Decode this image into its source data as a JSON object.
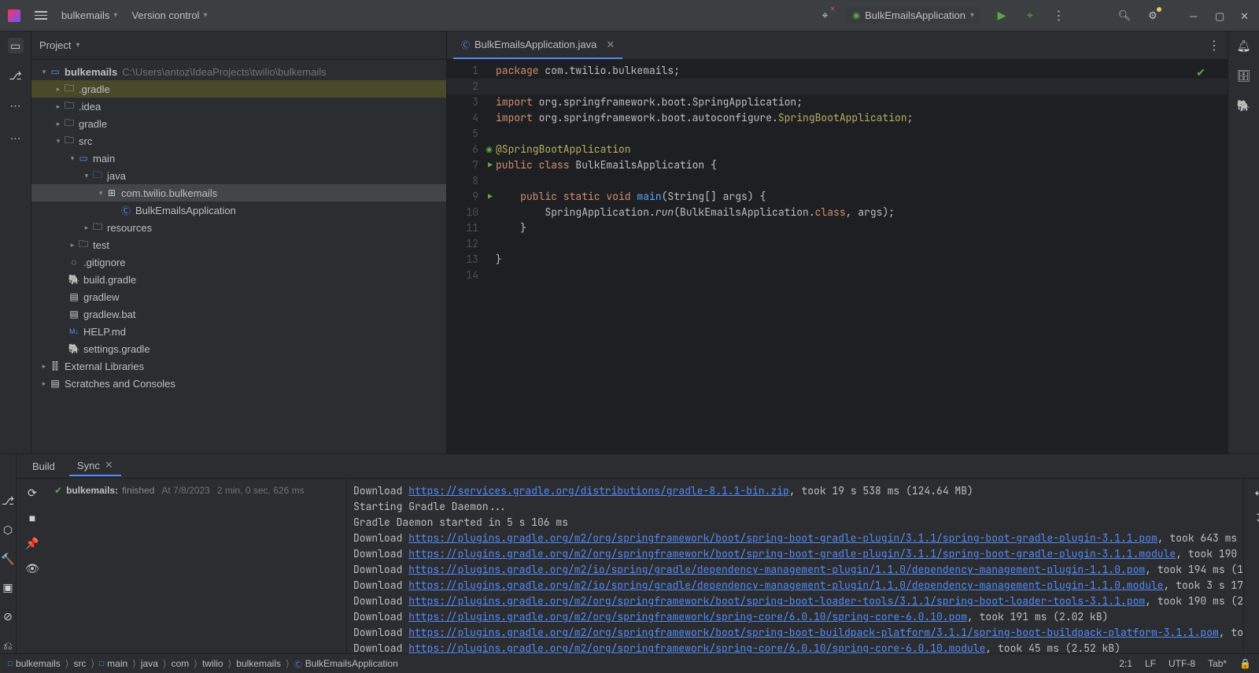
{
  "titlebar": {
    "project": "bulkemails",
    "vcs": "Version control",
    "run_config": "BulkEmailsApplication"
  },
  "project_panel": {
    "title": "Project",
    "root": "bulkemails",
    "root_path": "C:\\Users\\antoz\\IdeaProjects\\twilio\\bulkemails",
    "nodes": {
      "gradle_hidden": ".gradle",
      "idea": ".idea",
      "gradle": "gradle",
      "src": "src",
      "main": "main",
      "java": "java",
      "pkg": "com.twilio.bulkemails",
      "app": "BulkEmailsApplication",
      "resources": "resources",
      "test": "test",
      "gitignore": ".gitignore",
      "build_gradle": "build.gradle",
      "gradlew": "gradlew",
      "gradlew_bat": "gradlew.bat",
      "help_md": "HELP.md",
      "settings_gradle": "settings.gradle",
      "ext_lib": "External Libraries",
      "scratches": "Scratches and Consoles"
    }
  },
  "editor": {
    "tab": "BulkEmailsApplication.java",
    "code": [
      {
        "n": "1",
        "g": "",
        "t": "<span class='kw'>package</span> com.twilio.bulkemails;"
      },
      {
        "n": "2",
        "g": "",
        "t": ""
      },
      {
        "n": "3",
        "g": "",
        "t": "<span class='kw'>import</span> org.springframework.boot.SpringApplication;"
      },
      {
        "n": "4",
        "g": "",
        "t": "<span class='kw'>import</span> org.springframework.boot.autoconfigure.<span class='ann'>SpringBootApplication</span>;"
      },
      {
        "n": "5",
        "g": "",
        "t": ""
      },
      {
        "n": "6",
        "g": "s",
        "t": "<span class='ann'>@SpringBootApplication</span>"
      },
      {
        "n": "7",
        "g": "p",
        "t": "<span class='kw'>public class</span> BulkEmailsApplication {"
      },
      {
        "n": "8",
        "g": "",
        "t": ""
      },
      {
        "n": "9",
        "g": "p",
        "t": "    <span class='kw'>public static void</span> <span class='fn'>main</span>(String[] args) {"
      },
      {
        "n": "10",
        "g": "",
        "t": "        SpringApplication.<span class='it'>run</span>(BulkEmailsApplication.<span class='kw'>class</span>, args);"
      },
      {
        "n": "11",
        "g": "",
        "t": "    }"
      },
      {
        "n": "12",
        "g": "",
        "t": ""
      },
      {
        "n": "13",
        "g": "",
        "t": "}"
      },
      {
        "n": "14",
        "g": "",
        "t": ""
      }
    ]
  },
  "bottom": {
    "tab_build": "Build",
    "tab_sync": "Sync",
    "status_project": "bulkemails:",
    "status_text": "finished",
    "status_at": "At 7/8/2023",
    "status_dur": "2 min, 0 sec, 626 ms",
    "console_lines": [
      {
        "p": "Download ",
        "u": "https://services.gradle.org/distributions/gradle-8.1.1-bin.zip",
        "s": ", took 19 s 538 ms (124.64 MB)"
      },
      {
        "p": "Starting Gradle Daemon...",
        "u": "",
        "s": ""
      },
      {
        "p": "Gradle Daemon started in 5 s 106 ms",
        "u": "",
        "s": ""
      },
      {
        "p": "Download ",
        "u": "https://plugins.gradle.org/m2/org/springframework/boot/spring-boot-gradle-plugin/3.1.1/spring-boot-gradle-plugin-3.1.1.pom",
        "s": ", took 643 ms"
      },
      {
        "p": "Download ",
        "u": "https://plugins.gradle.org/m2/org/springframework/boot/spring-boot-gradle-plugin/3.1.1/spring-boot-gradle-plugin-3.1.1.module",
        "s": ", took 190"
      },
      {
        "p": "Download ",
        "u": "https://plugins.gradle.org/m2/io/spring/gradle/dependency-management-plugin/1.1.0/dependency-management-plugin-1.1.0.pom",
        "s": ", took 194 ms (1"
      },
      {
        "p": "Download ",
        "u": "https://plugins.gradle.org/m2/io/spring/gradle/dependency-management-plugin/1.1.0/dependency-management-plugin-1.1.0.module",
        "s": ", took 3 s 17"
      },
      {
        "p": "Download ",
        "u": "https://plugins.gradle.org/m2/org/springframework/boot/spring-boot-loader-tools/3.1.1/spring-boot-loader-tools-3.1.1.pom",
        "s": ", took 190 ms (2"
      },
      {
        "p": "Download ",
        "u": "https://plugins.gradle.org/m2/org/springframework/spring-core/6.0.10/spring-core-6.0.10.pom",
        "s": ", took 191 ms (2.02 kB)"
      },
      {
        "p": "Download ",
        "u": "https://plugins.gradle.org/m2/org/springframework/boot/spring-boot-buildpack-platform/3.1.1/spring-boot-buildpack-platform-3.1.1.pom",
        "s": ", to"
      },
      {
        "p": "Download ",
        "u": "https://plugins.gradle.org/m2/org/springframework/spring-core/6.0.10/spring-core-6.0.10.module",
        "s": ", took 45 ms (2.52 kB)"
      }
    ]
  },
  "breadcrumb": [
    {
      "i": "□",
      "t": "bulkemails"
    },
    {
      "i": "",
      "t": "src"
    },
    {
      "i": "□",
      "t": "main"
    },
    {
      "i": "",
      "t": "java"
    },
    {
      "i": "",
      "t": "com"
    },
    {
      "i": "",
      "t": "twilio"
    },
    {
      "i": "",
      "t": "bulkemails"
    },
    {
      "i": "Ⓒ",
      "t": "BulkEmailsApplication"
    }
  ],
  "statusbar": {
    "pos": "2:1",
    "eol": "LF",
    "enc": "UTF-8",
    "tab": "Tab*"
  }
}
